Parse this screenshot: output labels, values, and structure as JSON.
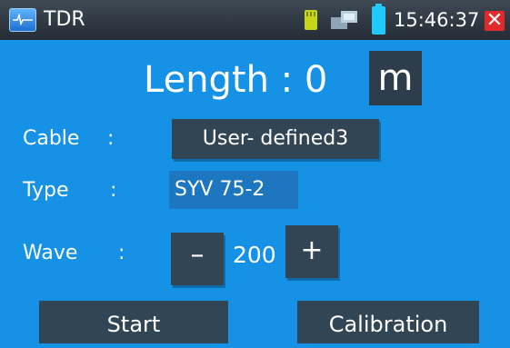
{
  "titlebar": {
    "app_title": "TDR",
    "time": "15:46:37",
    "icons": [
      "tdr-app-icon",
      "sd-card-icon",
      "network-icon",
      "battery-icon",
      "close-icon"
    ]
  },
  "main": {
    "length_label": "Length : 0",
    "length_unit": "m",
    "cable": {
      "label": "Cable",
      "colon": ":",
      "value": "User- defined3"
    },
    "type": {
      "label": "Type",
      "colon": ":",
      "value": "SYV 75-2"
    },
    "wave": {
      "label": "Wave",
      "colon": ":",
      "minus_label": "–",
      "value": "200",
      "plus_label": "+"
    }
  },
  "buttons": {
    "start": "Start",
    "calibration": "Calibration"
  },
  "colors": {
    "background": "#1591e6",
    "button": "#324555",
    "close": "#e32a2a",
    "battery": "#20c9ff"
  }
}
